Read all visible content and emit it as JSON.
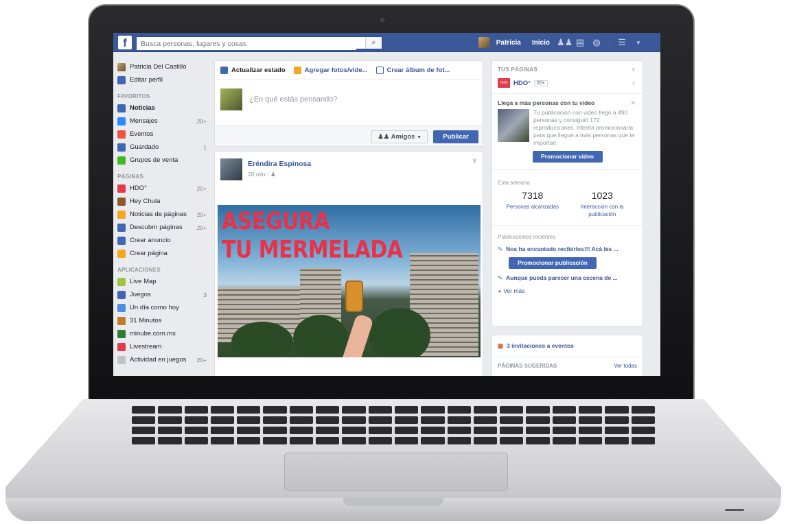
{
  "topbar": {
    "logo": "f",
    "search_placeholder": "Busca personas, lugares y cosas",
    "user_name": "Patricia",
    "home": "Inicio",
    "icons": [
      "friend-requests-icon",
      "messages-icon",
      "notifications-icon",
      "lock-icon",
      "menu-chevron-icon"
    ]
  },
  "sidebar": {
    "profile": [
      {
        "label": "Patricia Del Castillo",
        "icon": "avatar"
      },
      {
        "label": "Editar perfil",
        "icon": "edit-icon"
      }
    ],
    "favorites_heading": "FAVORITOS",
    "favorites": [
      {
        "label": "Noticias",
        "count": "",
        "icon": "news-feed-icon",
        "color": "#4267b2"
      },
      {
        "label": "Mensajes",
        "count": "20+",
        "icon": "messages-icon",
        "color": "#2d88ff"
      },
      {
        "label": "Eventos",
        "count": "",
        "icon": "calendar-icon",
        "color": "#e9573f"
      },
      {
        "label": "Guardado",
        "count": "1",
        "icon": "bookmark-icon",
        "color": "#4267b2"
      },
      {
        "label": "Grupos de venta",
        "count": "",
        "icon": "groups-icon",
        "color": "#42b72a"
      }
    ],
    "pages_heading": "PÁGINAS",
    "pages": [
      {
        "label": "HDO°",
        "count": "20+",
        "icon": "hdo-icon",
        "color": "#e23b4c"
      },
      {
        "label": "Hey Chula",
        "count": "",
        "icon": "page-icon",
        "color": "#8b5a2b"
      },
      {
        "label": "Noticias de páginas",
        "count": "20+",
        "icon": "megaphone-icon",
        "color": "#f5a623"
      },
      {
        "label": "Descubrir páginas",
        "count": "20+",
        "icon": "flag-icon",
        "color": "#4267b2"
      },
      {
        "label": "Crear anuncio",
        "count": "",
        "icon": "chart-icon",
        "color": "#4267b2"
      },
      {
        "label": "Crear página",
        "count": "",
        "icon": "plus-icon",
        "color": "#f5a623"
      }
    ],
    "apps_heading": "APLICACIONES",
    "apps": [
      {
        "label": "Live Map",
        "count": "",
        "icon": "map-icon",
        "color": "#9bc53d"
      },
      {
        "label": "Juegos",
        "count": "3",
        "icon": "games-icon",
        "color": "#4267b2"
      },
      {
        "label": "Un día como hoy",
        "count": "",
        "icon": "clock-icon",
        "color": "#4a90e2"
      },
      {
        "label": "31 Minutos",
        "count": "",
        "icon": "app-icon",
        "color": "#c47a2c"
      },
      {
        "label": "minube.com.mx",
        "count": "",
        "icon": "app-icon",
        "color": "#2f7d32"
      },
      {
        "label": "Livestream",
        "count": "",
        "icon": "video-icon",
        "color": "#e23b4c"
      },
      {
        "label": "Actividad en juegos",
        "count": "20+",
        "icon": "activity-icon",
        "color": "#bec3c9"
      }
    ]
  },
  "composer": {
    "tabs": [
      {
        "label": "Actualizar estado",
        "icon": "pencil-icon",
        "color": "#4267b2"
      },
      {
        "label": "Agregar fotos/vide...",
        "icon": "photo-icon",
        "color": "#f5a623"
      },
      {
        "label": "Crear álbum de fot...",
        "icon": "album-icon",
        "color": "#4267b2"
      }
    ],
    "placeholder": "¿En qué estás pensando?",
    "audience": "Amigos",
    "publish": "Publicar"
  },
  "post": {
    "author": "Eréndira Espinosa",
    "meta": "20 min · ",
    "image_text_line1": "ASEGURA",
    "image_text_line2": "TU MERMELADA"
  },
  "right": {
    "your_pages": "TUS PÁGINAS",
    "page_name": "HDO°",
    "page_badge": "20+",
    "promo_title": "Llega a más personas con tu video",
    "promo_desc": "Tu publicación con video llegó a 490 personas y consiguió 172 reproducciones. Intenta promocionarla para que llegue a más personas que te importan.",
    "promo_button": "Promocionar video",
    "week_label": "Esta semana",
    "stat1_value": "7318",
    "stat1_label": "Personas alcanzadas",
    "stat2_value": "1023",
    "stat2_label": "Interacción con la publicación",
    "recent_label": "Publicaciones recientes",
    "recent1": "Nos ha encantado recibirlos!!! Acá les ...",
    "promote_post": "Promocionar publicación",
    "recent2": "Aunque pueda parecer una escena de ...",
    "see_more": "Ver más",
    "invites": "3 invitaciones a eventos",
    "suggested": "PÁGINAS SUGERIDAS",
    "see_all": "Ver todas"
  }
}
